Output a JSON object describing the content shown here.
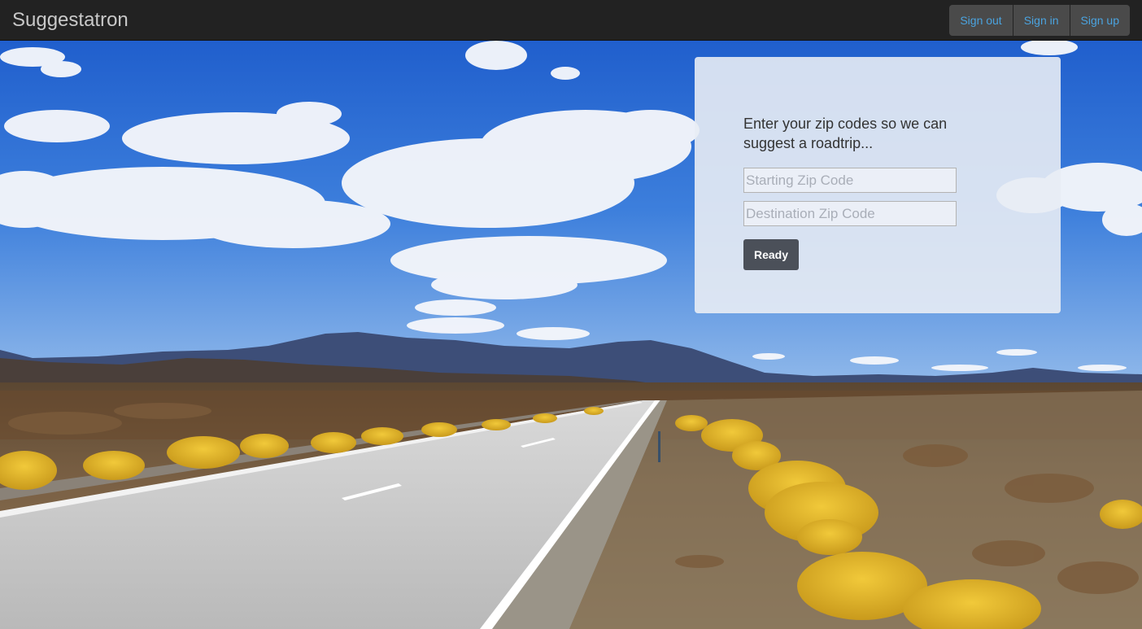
{
  "navbar": {
    "brand": "Suggestatron",
    "buttons": [
      {
        "label": "Sign out"
      },
      {
        "label": "Sign in"
      },
      {
        "label": "Sign up"
      }
    ]
  },
  "form": {
    "prompt": "Enter your zip codes so we can suggest a roadtrip...",
    "start": {
      "value": "",
      "placeholder": "Starting Zip Code"
    },
    "destination": {
      "value": "",
      "placeholder": "Destination Zip Code"
    },
    "submit_label": "Ready"
  },
  "colors": {
    "navbar_bg": "#222222",
    "nav_link": "#4aa3df",
    "button_dark": "#4b5059",
    "sky": "#2f6fd0"
  }
}
